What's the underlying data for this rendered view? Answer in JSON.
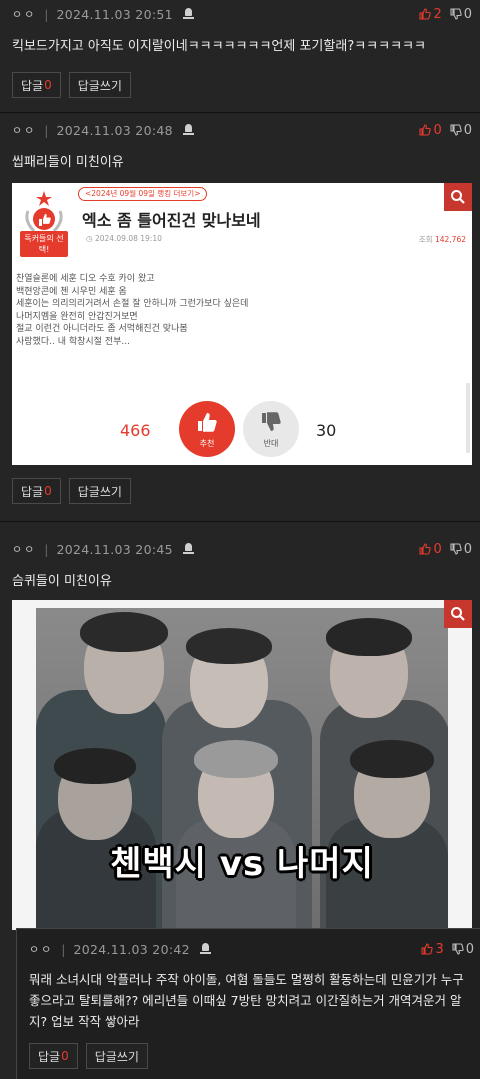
{
  "colors": {
    "accent": "#e53b2c",
    "background": "#252525",
    "text": "#ececec",
    "muted": "#9a9a9a"
  },
  "comments": [
    {
      "nick": "ㅇㅇ",
      "date": "2024.11.03 20:51",
      "up": "2",
      "down": "0",
      "text": "킥보드가지고 아직도 이지랄이네ㅋㅋㅋㅋㅋㅋㅋ언제 포기할래?ㅋㅋㅋㅋㅋㅋ",
      "reply_label": "답글",
      "reply_count": "0",
      "write_label": "답글쓰기"
    },
    {
      "nick": "ㅇㅇ",
      "date": "2024.11.03 20:48",
      "up": "0",
      "down": "0",
      "text": "씹패리들이 미친이유",
      "reply_label": "답글",
      "reply_count": "0",
      "write_label": "답글쓰기"
    },
    {
      "nick": "ㅇㅇ",
      "date": "2024.11.03 20:45",
      "up": "0",
      "down": "0",
      "text": "슴퀴들이 미친이유",
      "reply_label": "답글",
      "reply_count": "0",
      "write_label": "답글쓰기"
    },
    {
      "nick": "ㅇㅇ",
      "date": "2024.11.03 20:42",
      "up": "3",
      "down": "0",
      "text": "뭐래 소녀시대 악플러나 주작 아이돌, 여혐 돌들도 멀쩡히 활동하는데 민윤기가 누구 좋으라고 탈퇴를해?? 에리년들 이때싶 7방탄 망치려고 이간질하는거 개역겨운거 알지? 업보 작작 쌓아라",
      "reply_label": "답글",
      "reply_count": "0",
      "write_label": "답글쓰기"
    }
  ],
  "image1": {
    "badge_text": "독커들의 선택!",
    "tag": "<2024년 09월 09일 랭킹 더보기>",
    "title": "엑소 좀 틀어진건 맞나보네",
    "date": "2024.09.08 19:10",
    "views_label": "조회",
    "views": "142,762",
    "body_lines": [
      "찬열슬론에 세훈 디오 수호 카이 왔고",
      "백현앙콘에 첸 시우민 세훈 옴",
      "세훈이는 의리의리거려서 손절 잘 안하니까 그런가보다 싶은데",
      "나머지멤을 완전히 안갑진거보면",
      "절교 이런건 아니더라도 좀 서먹해진건 맞나봄",
      "사랑했다.. 내 학창시절 전부..."
    ],
    "recommend_count": "466",
    "recommend_label": "추천",
    "dislike_label": "반대",
    "dislike_count": "30"
  },
  "image2": {
    "caption": "첸백시 vs 나머지"
  }
}
